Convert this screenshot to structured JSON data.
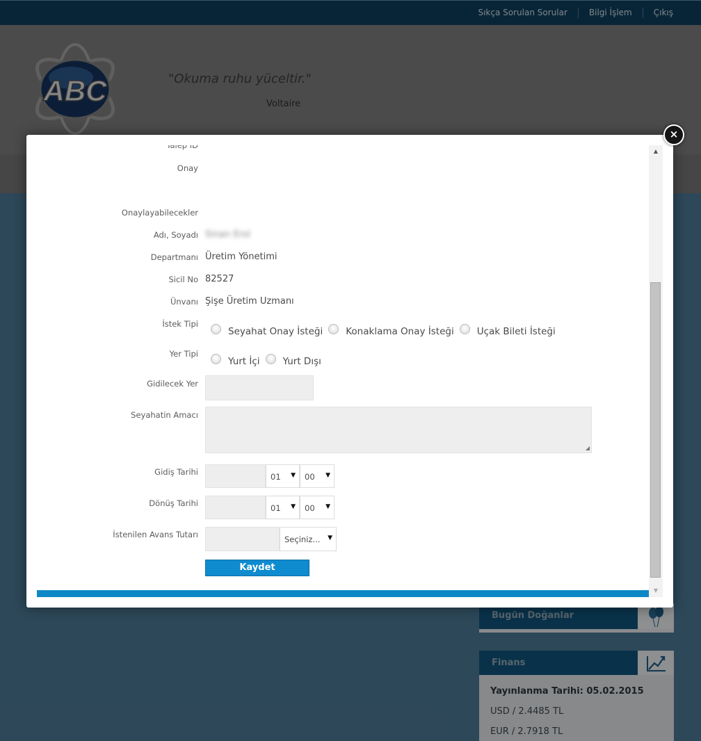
{
  "topnav": {
    "faq": "Sıkça Sorulan Sorular",
    "it": "Bilgi İşlem",
    "logout": "Çıkış"
  },
  "header": {
    "logo_text": "ABC",
    "quote": "\"Okuma ruhu yüceltir.\"",
    "author": "Voltaire"
  },
  "sidebar": {
    "birthdays_title": "Bugün Doğanlar",
    "finans": {
      "title": "Finans",
      "published": "Yayınlanma Tarihi: 05.02.2015",
      "usd": "USD / 2.4485 TL",
      "eur": "EUR / 2.7918 TL"
    }
  },
  "modal": {
    "close_symbol": "×",
    "labels": {
      "talep_id": "Talep ID",
      "onay": "Onay",
      "onaylayabilecekler": "Onaylayabilecekler",
      "adi_soyadi": "Adı, Soyadı",
      "departman": "Departmanı",
      "sicil": "Sicil No",
      "unvan": "Ünvanı",
      "istek_tipi": "İstek Tipi",
      "yer_tipi": "Yer Tipi",
      "gidilecek_yer": "Gidilecek Yer",
      "seyahat_amaci": "Seyahatin Amacı",
      "gidis_tarihi": "Gidiş Tarihi",
      "donus_tarihi": "Dönüş Tarihi",
      "avans_tutari": "İstenilen Avans Tutarı"
    },
    "values": {
      "adi_soyadi": "Sinan Erol",
      "departman": "Üretim Yönetimi",
      "sicil": "82527",
      "unvan": "Şişe Üretim Uzmanı"
    },
    "istek_options": [
      "Seyahat Onay İsteği",
      "Konaklama Onay İsteği",
      "Uçak Bileti İsteği"
    ],
    "yer_options": [
      "Yurt İçi",
      "Yurt Dışı"
    ],
    "gidis": {
      "hour": "01",
      "minute": "00"
    },
    "donus": {
      "hour": "01",
      "minute": "00"
    },
    "currency_select": "Seçiniz...",
    "save_label": "Kaydet"
  }
}
